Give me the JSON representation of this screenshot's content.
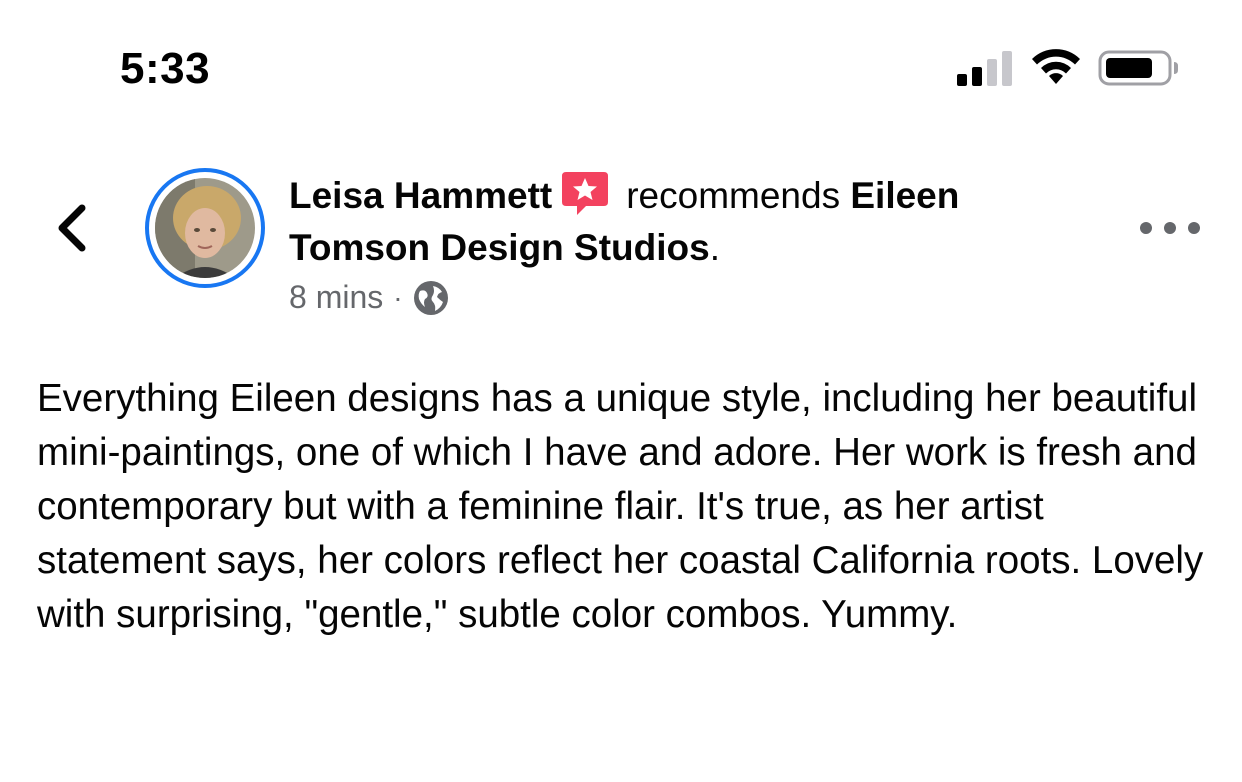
{
  "status_bar": {
    "time": "5:33",
    "icons": [
      "cellular-signal-icon",
      "wifi-icon",
      "battery-icon"
    ]
  },
  "post": {
    "author": "Leisa Hammett",
    "verb": "recommends",
    "page_name": "Eileen Tomson Design Studios",
    "headline_end": ".",
    "timestamp": "8 mins",
    "separator": "·",
    "privacy_icon": "globe-icon",
    "body": "Everything Eileen designs has a unique style, including her beautiful mini-paintings, one of which I have and adore. Her work is fresh and contemporary but with a feminine flair. It's true, as her artist statement says, her colors reflect her coastal California roots. Lovely with surprising, \"gentle,\" subtle color combos. Yummy."
  },
  "colors": {
    "accent": "#1877f2",
    "recommendation_badge": "#f3425f",
    "meta_text": "#65676b",
    "text": "#050505"
  }
}
